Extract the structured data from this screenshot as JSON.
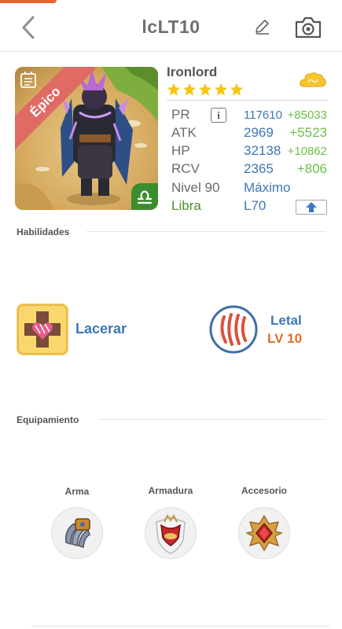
{
  "header": {
    "title": "lcLT10",
    "back_icon": "chevron-left-icon",
    "edit_icon": "pencil-icon",
    "camera_icon": "camera-icon"
  },
  "hero": {
    "name": "Ironlord",
    "rarity_label": "Épico",
    "star_count": 5,
    "zodiac": "Libra",
    "colors": {
      "rarity_ribbon": "#e06a64",
      "zodiac_badge": "#3c8d2f",
      "star": "#f5c518"
    }
  },
  "stats": {
    "pr": {
      "label": "PR",
      "base": "117610",
      "bonus": "+85033"
    },
    "atk": {
      "label": "ATK",
      "base": "2969",
      "bonus": "+5523"
    },
    "hp": {
      "label": "HP",
      "base": "32138",
      "bonus": "+10862"
    },
    "rcv": {
      "label": "RCV",
      "base": "2365",
      "bonus": "+806"
    },
    "level": {
      "label": "Nivel 90",
      "value": "Máximo"
    },
    "zodiac_level": "L70",
    "info_glyph": "i"
  },
  "sections": {
    "skills_title": "Habilidades",
    "equipment_title": "Equipamiento"
  },
  "skills": [
    {
      "name": "Lacerar",
      "icon": "heart-cross-icon"
    },
    {
      "name": "Letal",
      "level": "LV 10",
      "icon": "claw-marks-icon"
    }
  ],
  "equipment": [
    {
      "label": "Arma",
      "icon": "claw-weapon-icon"
    },
    {
      "label": "Armadura",
      "icon": "armor-shield-icon"
    },
    {
      "label": "Accesorio",
      "icon": "red-gem-icon"
    }
  ]
}
